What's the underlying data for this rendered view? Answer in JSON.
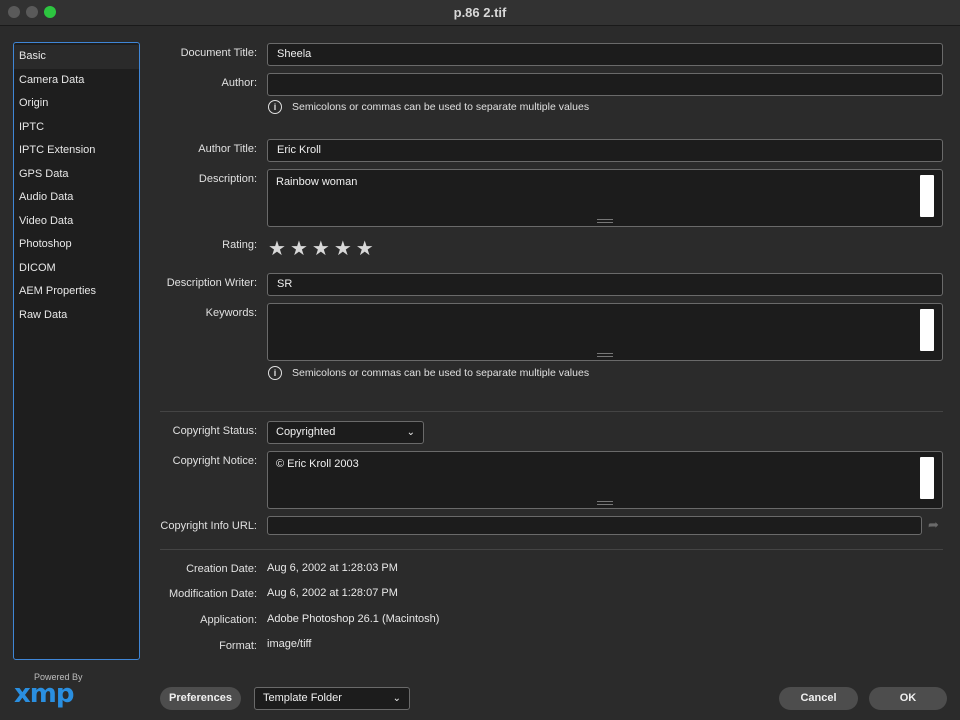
{
  "window": {
    "title": "p.86 2.tif"
  },
  "sidebar": {
    "items": [
      {
        "label": "Basic"
      },
      {
        "label": "Camera Data"
      },
      {
        "label": "Origin"
      },
      {
        "label": "IPTC"
      },
      {
        "label": "IPTC Extension"
      },
      {
        "label": "GPS Data"
      },
      {
        "label": "Audio Data"
      },
      {
        "label": "Video Data"
      },
      {
        "label": "Photoshop"
      },
      {
        "label": "DICOM"
      },
      {
        "label": "AEM Properties"
      },
      {
        "label": "Raw Data"
      }
    ],
    "selected": "Basic"
  },
  "logo": {
    "powered_by": "Powered By",
    "text": "xmp",
    "color": "#2a8fe0"
  },
  "form": {
    "document_title": {
      "label": "Document Title:",
      "value": "Sheela"
    },
    "author": {
      "label": "Author:",
      "value": ""
    },
    "hint": "Semicolons or commas can be used to separate multiple values",
    "author_title": {
      "label": "Author Title:",
      "value": "Eric Kroll"
    },
    "description": {
      "label": "Description:",
      "value": "Rainbow woman"
    },
    "rating": {
      "label": "Rating:",
      "stars": 5,
      "star_glyph": "★"
    },
    "description_writer": {
      "label": "Description Writer:",
      "value": "SR"
    },
    "keywords": {
      "label": "Keywords:",
      "value": ""
    },
    "copyright_status": {
      "label": "Copyright Status:",
      "value": "Copyrighted"
    },
    "copyright_notice": {
      "label": "Copyright Notice:",
      "value": "© Eric Kroll 2003"
    },
    "copyright_url": {
      "label": "Copyright Info URL:",
      "value": ""
    }
  },
  "info": {
    "creation_date": {
      "label": "Creation Date:",
      "value": "Aug 6, 2002 at 1:28:03 PM"
    },
    "modification_date": {
      "label": "Modification Date:",
      "value": "Aug 6, 2002 at 1:28:07 PM"
    },
    "application": {
      "label": "Application:",
      "value": "Adobe Photoshop 26.1 (Macintosh)"
    },
    "format": {
      "label": "Format:",
      "value": "image/tiff"
    }
  },
  "footer": {
    "preferences": "Preferences",
    "template_folder": "Template Folder",
    "cancel": "Cancel",
    "ok": "OK"
  },
  "icons": {
    "info": "i",
    "chevron": "⌄",
    "go": "➦"
  }
}
